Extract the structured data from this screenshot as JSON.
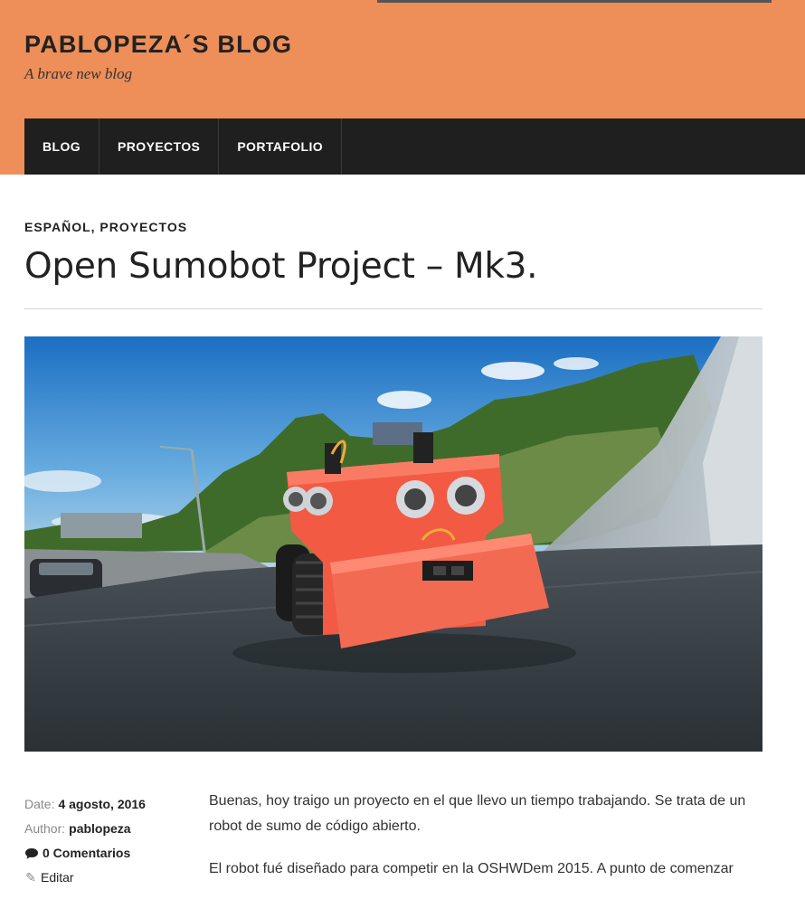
{
  "site": {
    "title": "PABLOPEZA´S BLOG",
    "description": "A brave new blog"
  },
  "nav": {
    "items": [
      {
        "label": "BLOG"
      },
      {
        "label": "PROYECTOS"
      },
      {
        "label": "PORTAFOLIO"
      }
    ]
  },
  "post": {
    "categories": [
      "ESPAÑOL",
      "PROYECTOS"
    ],
    "category_separator": ", ",
    "title": "Open Sumobot Project – Mk3.",
    "meta": {
      "date_label": "Date:",
      "date": "4 agosto, 2016",
      "author_label": "Author:",
      "author": "pablopeza",
      "comments": "0 Comentarios",
      "edit": "Editar"
    },
    "paragraphs": [
      "Buenas, hoy traigo un proyecto en el que llevo un tiempo trabajando. Se trata de un robot de sumo de código abierto.",
      "El robot fué diseñado para competir en la OSHWDem 2015. A punto de comenzar"
    ]
  },
  "colors": {
    "header": "#ee8e58",
    "nav": "#1f1f1f",
    "robot": "#f25a44"
  }
}
